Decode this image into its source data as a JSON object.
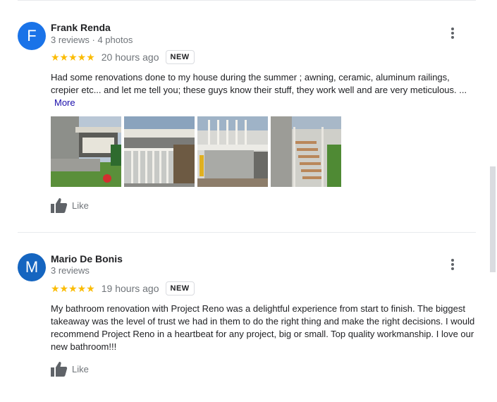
{
  "reviews": [
    {
      "initial": "F",
      "avatar_color": "#1a73e8",
      "name": "Frank Renda",
      "meta": "3 reviews · 4 photos",
      "stars": "★★★★★",
      "time": "20 hours ago",
      "badge": "NEW",
      "text": "Had some renovations done to my house during the summer ; awning, ceramic, aluminum railings, crepier etc... and let me tell you; these guys know their stuff, they work well and are very meticulous. ...",
      "more_label": "More",
      "like_label": "Like",
      "photo_icons": [
        "photo-thumbnail-awning",
        "photo-thumbnail-railing",
        "photo-thumbnail-deck",
        "photo-thumbnail-stairs"
      ]
    },
    {
      "initial": "M",
      "avatar_color": "#1565c0",
      "name": "Mario De Bonis",
      "meta": "3 reviews",
      "stars": "★★★★★",
      "time": "19 hours ago",
      "badge": "NEW",
      "text": "My bathroom renovation with Project Reno was a delightful experience from start to finish. The biggest takeaway was the level of trust we had in them to do the right thing and make the right decisions. I would recommend Project Reno in a heartbeat for any project, big or small. Top quality workmanship. I love our new bathroom!!!",
      "like_label": "Like"
    }
  ]
}
